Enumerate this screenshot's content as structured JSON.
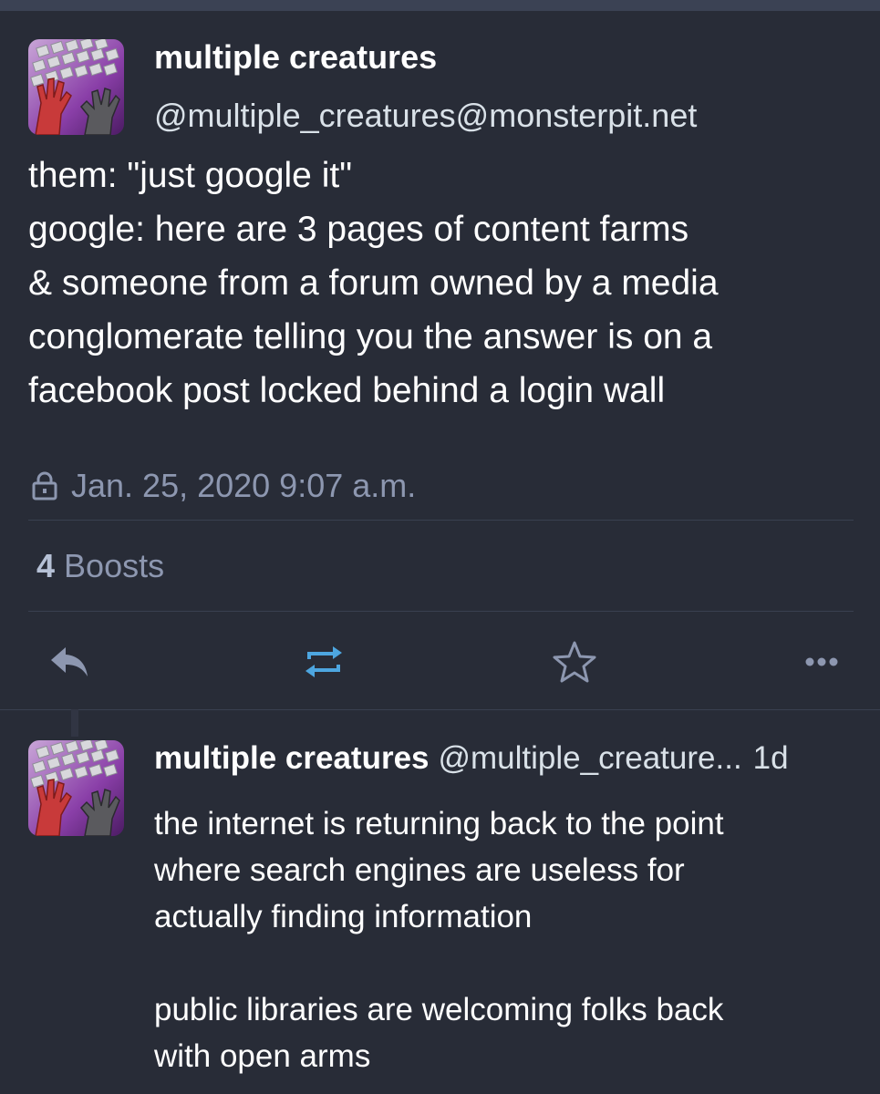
{
  "status": {
    "author": {
      "display_name": "multiple creatures",
      "handle": "@multiple_creatures@monsterpit.net",
      "avatar_icon": "keyboard-hands-avatar"
    },
    "content_lines": [
      "them: \"just google it\"",
      "google: here are 3 pages of content farms",
      "& someone from a forum owned by a media",
      "conglomerate telling you the answer is on a",
      "facebook post locked behind a login wall"
    ],
    "visibility_icon": "lock-icon",
    "timestamp": "Jan. 25, 2020 9:07 a.m.",
    "boosts": {
      "count": "4",
      "label": "Boosts"
    },
    "actions": [
      {
        "name": "reply",
        "icon": "reply-icon"
      },
      {
        "name": "boost",
        "icon": "boost-icon",
        "color": "#4da6e0"
      },
      {
        "name": "favourite",
        "icon": "star-icon"
      },
      {
        "name": "more",
        "icon": "more-icon"
      }
    ]
  },
  "reply": {
    "display_name": "multiple creatures",
    "handle": "@multiple_creature...",
    "time": "1d",
    "avatar_icon": "keyboard-hands-avatar",
    "paragraphs": [
      [
        "the internet is returning back to the point",
        "where search engines are useless for",
        "actually finding information"
      ],
      [
        "public libraries are welcoming folks back",
        "with open arms"
      ]
    ]
  },
  "colors": {
    "background": "#282c37",
    "secondary_text": "#8d97b0",
    "boost_accent": "#4da6e0"
  }
}
